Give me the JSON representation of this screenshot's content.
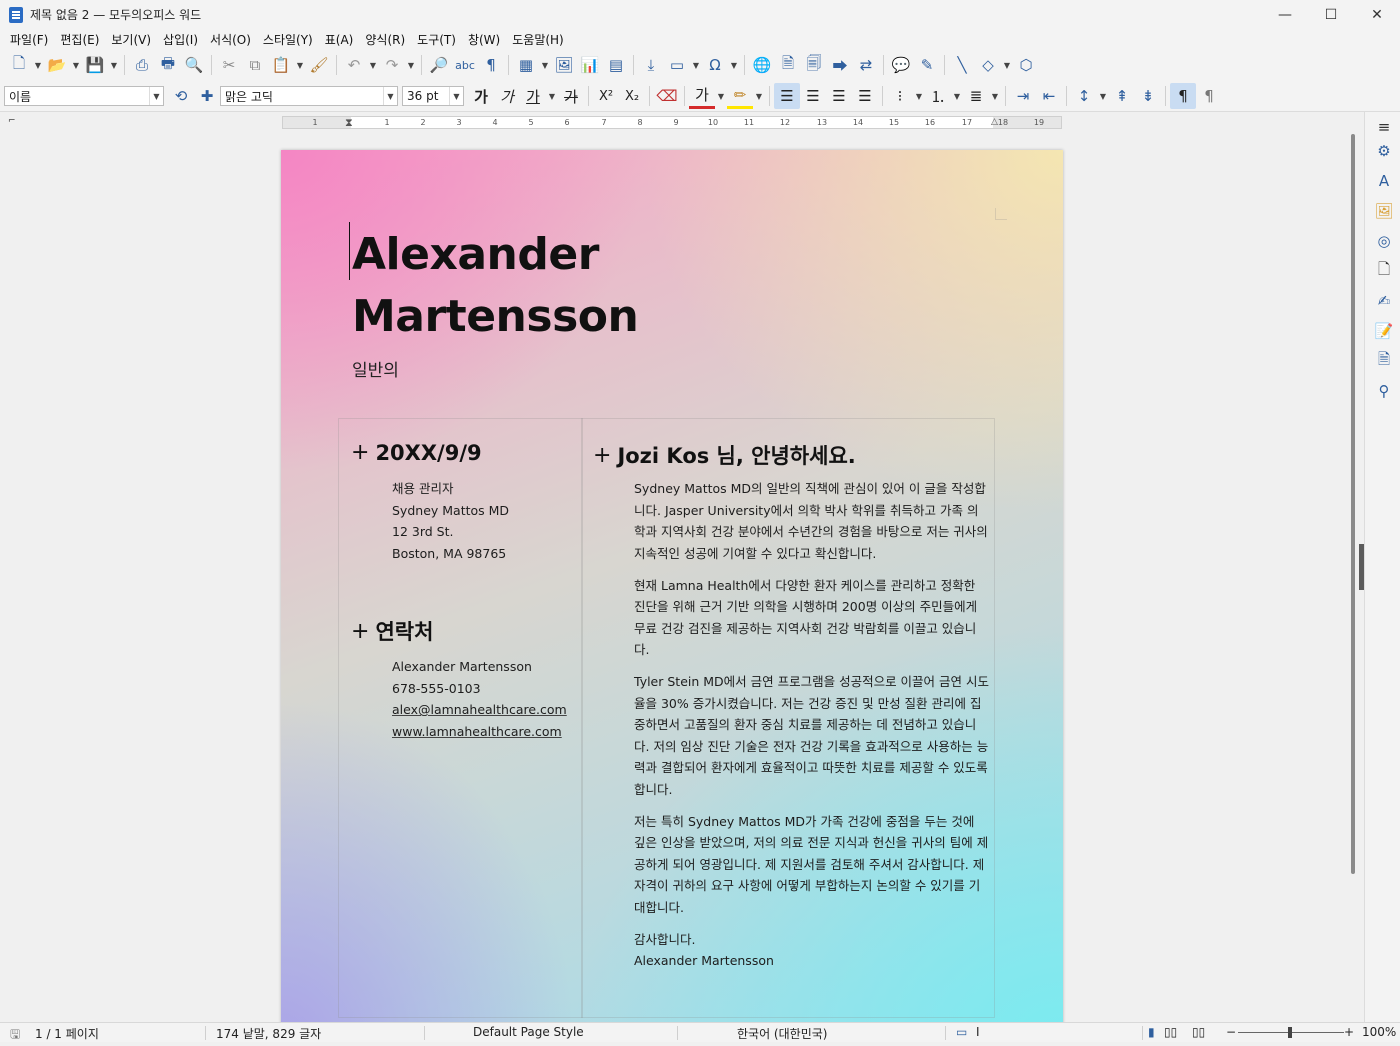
{
  "window": {
    "title": "제목 없음 2 — 모두의오피스 워드",
    "minimize_glyph": "—",
    "maximize_glyph": "☐",
    "close_glyph": "✕"
  },
  "menu": [
    "파일(F)",
    "편집(E)",
    "보기(V)",
    "삽입(I)",
    "서식(O)",
    "스타일(Y)",
    "표(A)",
    "양식(R)",
    "도구(T)",
    "창(W)",
    "도움말(H)"
  ],
  "toolbar": {
    "paragraph_style": "이름",
    "font_name": "맑은 고딕",
    "font_size": "36 pt",
    "bold_label": "가",
    "italic_label": "가",
    "underline_label": "가",
    "strike_label": "가",
    "superscript_label": "X²",
    "subscript_label": "X₂",
    "font_color_label": "가",
    "spellcheck_label": "abc"
  },
  "ruler": {
    "numbers": [
      "1",
      "1",
      "2",
      "3",
      "4",
      "5",
      "6",
      "7",
      "8",
      "9",
      "10",
      "11",
      "12",
      "13",
      "14",
      "15",
      "16",
      "17",
      "18",
      "19"
    ]
  },
  "document": {
    "name_line1": "Alexander",
    "name_line2": "Martensson",
    "subtitle": "일반의",
    "date_heading": "20XX/9/9",
    "recipient": [
      "채용 관리자",
      "Sydney Mattos MD",
      "12 3rd St.",
      "Boston, MA 98765"
    ],
    "contact_heading": "연락처",
    "contact": {
      "name": "Alexander Martensson",
      "phone": "678-555-0103",
      "email": "alex@lamnahealthcare.com",
      "website": "www.lamnahealthcare.com"
    },
    "greeting": "Jozi Kos 님, 안녕하세요.",
    "paragraphs": [
      "Sydney Mattos MD의 일반의 직책에 관심이 있어 이 글을 작성합니다. Jasper University에서 의학 박사 학위를 취득하고 가족 의학과 지역사회 건강 분야에서 수년간의 경험을 바탕으로 저는 귀사의 지속적인 성공에 기여할 수 있다고 확신합니다.",
      "현재 Lamna Health에서 다양한 환자 케이스를 관리하고 정확한 진단을 위해 근거 기반 의학을 시행하며 200명 이상의 주민들에게 무료 건강 검진을 제공하는 지역사회 건강 박람회를 이끌고 있습니다.",
      "Tyler Stein MD에서 금연 프로그램을 성공적으로 이끌어 금연 시도율을 30% 증가시켰습니다. 저는 건강 증진 및 만성 질환 관리에 집중하면서 고품질의 환자 중심 치료를 제공하는 데 전념하고 있습니다. 저의 임상 진단 기술은 전자 건강 기록을 효과적으로 사용하는 능력과 결합되어 환자에게 효율적이고 따뜻한 치료를 제공할 수 있도록 합니다.",
      "저는 특히 Sydney Mattos MD가 가족 건강에 중점을 두는 것에 깊은 인상을 받았으며, 저의 의료 전문 지식과 헌신을 귀사의 팀에 제공하게 되어 영광입니다. 제 지원서를 검토해 주셔서 감사합니다. 제 자격이 귀하의 요구 사항에 어떻게 부합하는지 논의할 수 있기를 기대합니다."
    ],
    "closing": "감사합니다.",
    "signature": "Alexander Martensson"
  },
  "status": {
    "page": "1 / 1 페이지",
    "words": "174 낱말, 829 글자",
    "page_style": "Default Page Style",
    "language": "한국어 (대한민국)",
    "zoom": "100%"
  },
  "colors": {
    "accent": "#2f5f9e",
    "page_pink": "#f484c4",
    "page_cyan": "#78ecf0"
  }
}
